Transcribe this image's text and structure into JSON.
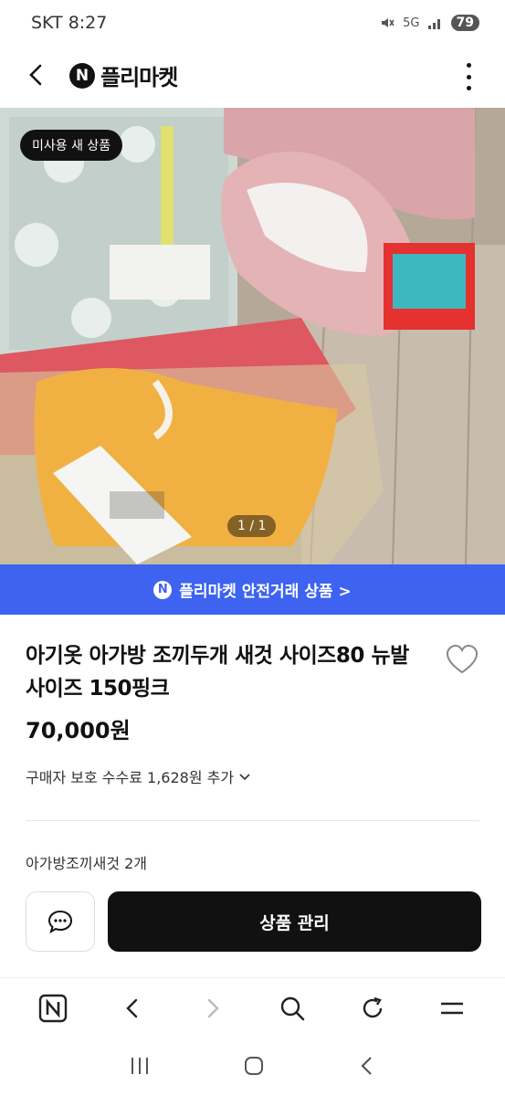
{
  "status_bar": {
    "carrier_time": "SKT 8:27",
    "network": "5G",
    "battery": "79"
  },
  "header": {
    "logo_letter": "N",
    "logo_text": "플리마켓"
  },
  "product": {
    "badge": "미사용 새 상품",
    "image_counter": "1 / 1",
    "safe_trade_letter": "N",
    "safe_trade_label": "플리마켓 안전거래 상품 >",
    "title": "아기옷 아가방 조끼두개 새것 사이즈80 뉴발사이즈 150핑크",
    "price": "70,000원",
    "fee_label": "구매자 보호 수수료 1,628원 추가",
    "description": "아가방조끼새것 2개"
  },
  "actions": {
    "manage_label": "상품 관리"
  },
  "icons": {
    "back": "chevron-left-icon",
    "more": "more-vertical-icon",
    "heart": "heart-outline-icon",
    "chat": "chat-bubble-icon",
    "fee_expand": "chevron-down-icon"
  },
  "colors": {
    "safe_banner": "#3d63f0",
    "primary_button": "#111111"
  }
}
